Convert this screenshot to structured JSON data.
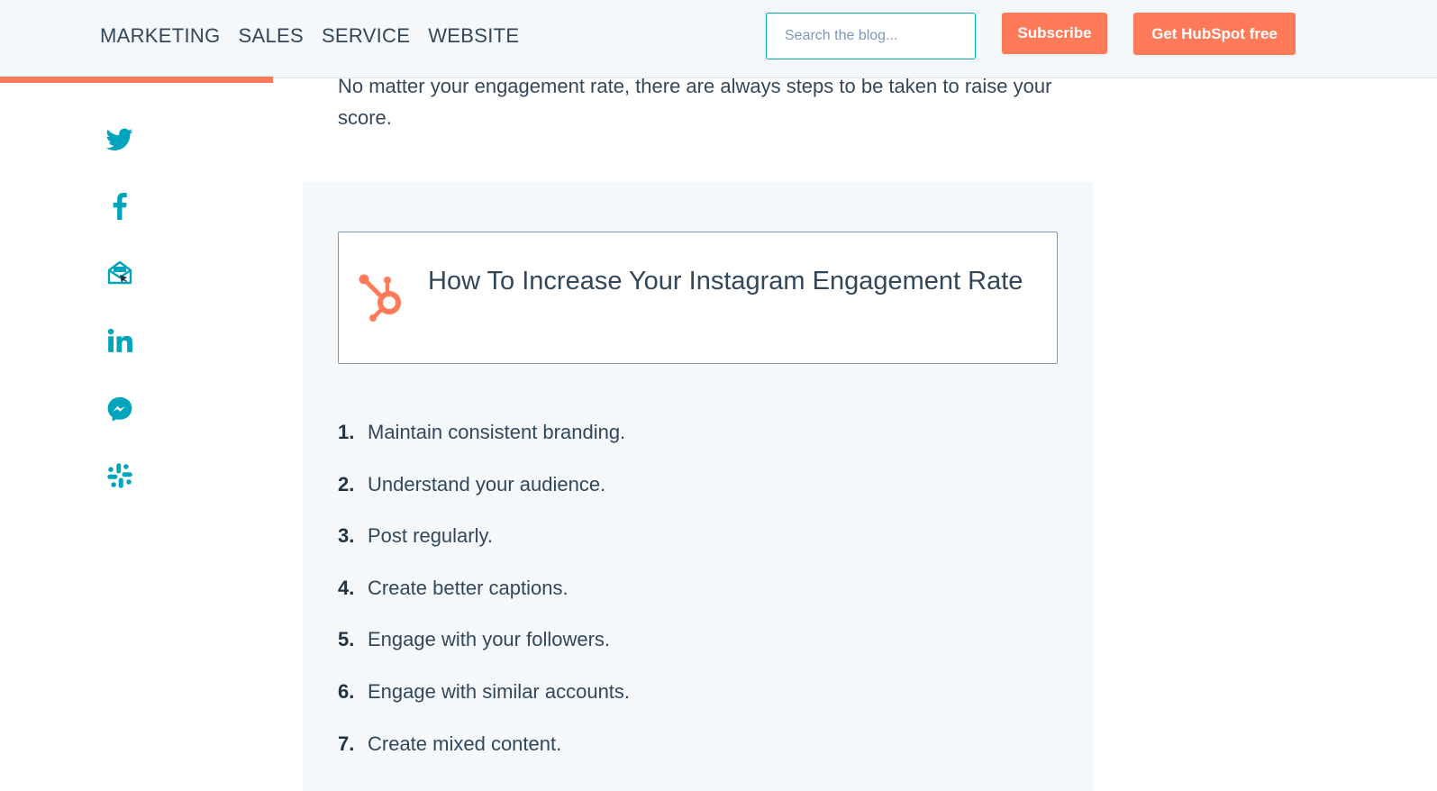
{
  "nav": {
    "items": [
      "MARKETING",
      "SALES",
      "SERVICE",
      "WEBSITE"
    ]
  },
  "search": {
    "placeholder": "Search the blog...",
    "icon": "search-icon"
  },
  "buttons": {
    "subscribe": "Subscribe",
    "get_free": "Get HubSpot free"
  },
  "reading_progress": 0.19,
  "social": {
    "icons": [
      "twitter-icon",
      "facebook-icon",
      "email-icon",
      "linkedin-icon",
      "messenger-icon",
      "slack-icon"
    ]
  },
  "article": {
    "intro": "No matter your engagement rate, there are always steps to be taken to raise your score."
  },
  "callout": {
    "title": "How To Increase Your Instagram Engagement Rate",
    "steps": [
      {
        "num": "1.",
        "text": "Maintain consistent branding."
      },
      {
        "num": "2.",
        "text": "Understand your audience."
      },
      {
        "num": "3.",
        "text": "Post regularly."
      },
      {
        "num": "4.",
        "text": "Create better captions."
      },
      {
        "num": "5.",
        "text": "Engage with your followers."
      },
      {
        "num": "6.",
        "text": "Engage with similar accounts."
      },
      {
        "num": "7.",
        "text": "Create mixed content."
      }
    ]
  },
  "colors": {
    "accent_orange": "#ff7a59",
    "accent_teal": "#00a4bd",
    "text": "#33475b",
    "panel_bg": "#f5f8fa"
  }
}
